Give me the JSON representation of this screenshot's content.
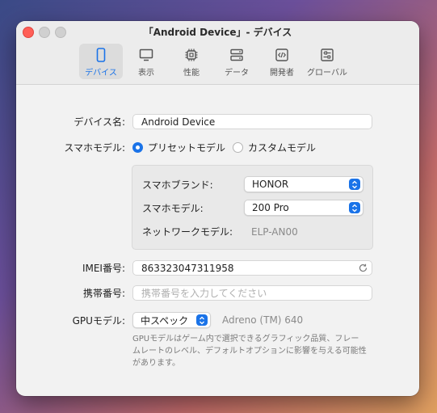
{
  "window": {
    "title": "「Android Device」- デバイス"
  },
  "tabs": [
    {
      "label": "デバイス",
      "icon": "phone-icon",
      "active": true
    },
    {
      "label": "表示",
      "icon": "monitor-icon"
    },
    {
      "label": "性能",
      "icon": "cpu-icon"
    },
    {
      "label": "データ",
      "icon": "storage-icon"
    },
    {
      "label": "開発者",
      "icon": "code-icon"
    },
    {
      "label": "グローバル",
      "icon": "sliders-icon"
    }
  ],
  "form": {
    "device_name_label": "デバイス名:",
    "device_name_value": "Android Device",
    "model_mode_label": "スマホモデル:",
    "radio_preset": "プリセットモデル",
    "radio_custom": "カスタムモデル",
    "brand_label": "スマホブランド:",
    "brand_value": "HONOR",
    "model_label": "スマホモデル:",
    "model_value": "200 Pro",
    "network_model_label": "ネットワークモデル:",
    "network_model_value": "ELP-AN00",
    "imei_label": "IMEI番号:",
    "imei_value": "863323047311958",
    "phone_label": "携帯番号:",
    "phone_placeholder": "携帯番号を入力してください",
    "gpu_label": "GPUモデル:",
    "gpu_value": "中スペック",
    "gpu_name": "Adreno (TM) 640",
    "gpu_desc_line1": "GPUモデルはゲーム内で選択できるグラフィック品質、フレー",
    "gpu_desc_line2": "ムレートのレベル、デフォルトオプションに影響を与える可能性",
    "gpu_desc_line3": "があります。"
  },
  "colors": {
    "accent": "#1a73e8",
    "close": "#ff5f57"
  }
}
